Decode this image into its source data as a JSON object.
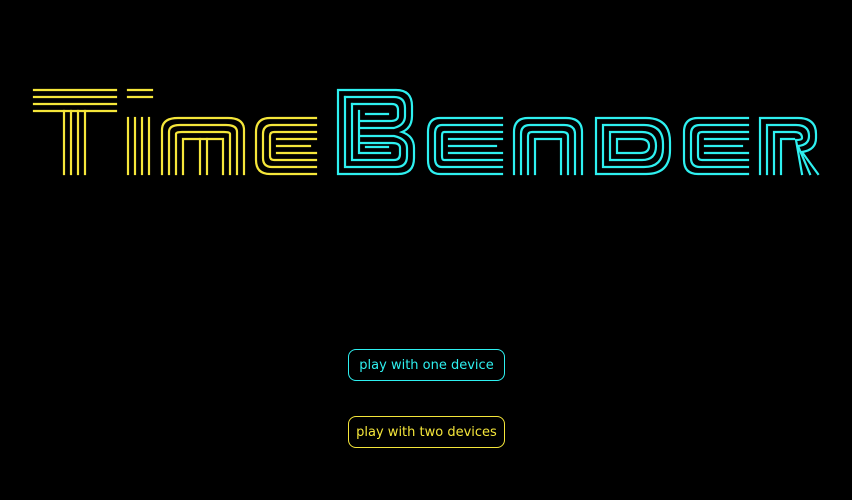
{
  "title": {
    "word1": "Time",
    "word2": "Bender",
    "word1_color": "#f5e63a",
    "word2_color": "#2ef0f0"
  },
  "menu": {
    "one_device_label": "play with one device",
    "one_device_color": "#2ef0f0",
    "two_devices_label": "play with two devices",
    "two_devices_color": "#f5e63a"
  }
}
